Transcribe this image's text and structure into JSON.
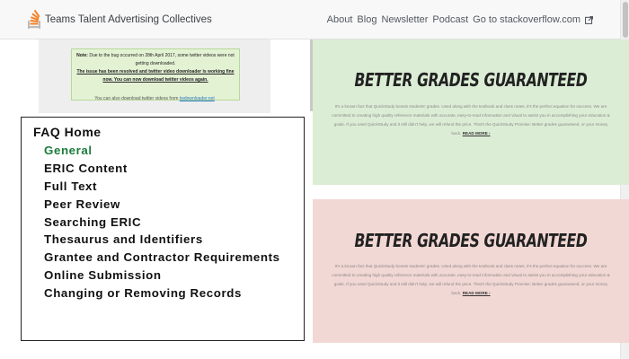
{
  "topbar": {
    "brand_teams": "Teams",
    "brand_rest": "Talent Advertising Collectives",
    "nav": [
      "About",
      "Blog",
      "Newsletter",
      "Podcast",
      "Go to stackoverflow.com"
    ]
  },
  "note": {
    "line1_label": "Note:",
    "line1_text": "Due to the bug occurred on 28th April 2017, some twitter videos were not getting downloaded.",
    "line2": "The issue has been resolved and twitter video downloader is working fine now. You can now download twitter videos again.",
    "also_text": "You can also download twitter videos from",
    "also_link": "twdownloader.net"
  },
  "faq": {
    "home": "FAQ Home",
    "items": [
      "General",
      "ERIC Content",
      "Full Text",
      "Peer Review",
      "Searching ERIC",
      "Thesaurus and Identifiers",
      "Grantee and Contractor Requirements",
      "Online Submission",
      "Changing or Removing Records"
    ]
  },
  "banners": [
    {
      "title": "BETTER GRADES GUARANTEED",
      "body": "It's a known fact that QuickStudy boosts students' grades. Used along with the textbook and class notes, it's the perfect equation for success. We are committed to creating high quality reference materials with accurate, easy-to-read information and visual to assist you in accomplishing your education & goals. If you used QuickStudy and it still didn't help, we will refund the price. That's the QuickStudy Promise: Better grades guaranteed, or your money back.",
      "link": "READ MORE ›"
    },
    {
      "title": "BETTER GRADES GUARANTEED",
      "body": "It's a known fact that QuickStudy boosts students' grades. Used along with the textbook and class notes, it's the perfect equation for success. We are committed to creating high quality reference materials with accurate, easy-to-read information and visual to assist you in accomplishing your education & goals. If you used QuickStudy and it still didn't help, we will refund the price. That's the QuickStudy Promise: Better grades guaranteed, or your money back.",
      "link": "READ MORE ›"
    }
  ],
  "colors": {
    "faq_active": "#1a7a3a",
    "banner_green": "#dcedd6",
    "banner_red": "#f2d8d4",
    "note_bg": "#e4f2d4"
  }
}
